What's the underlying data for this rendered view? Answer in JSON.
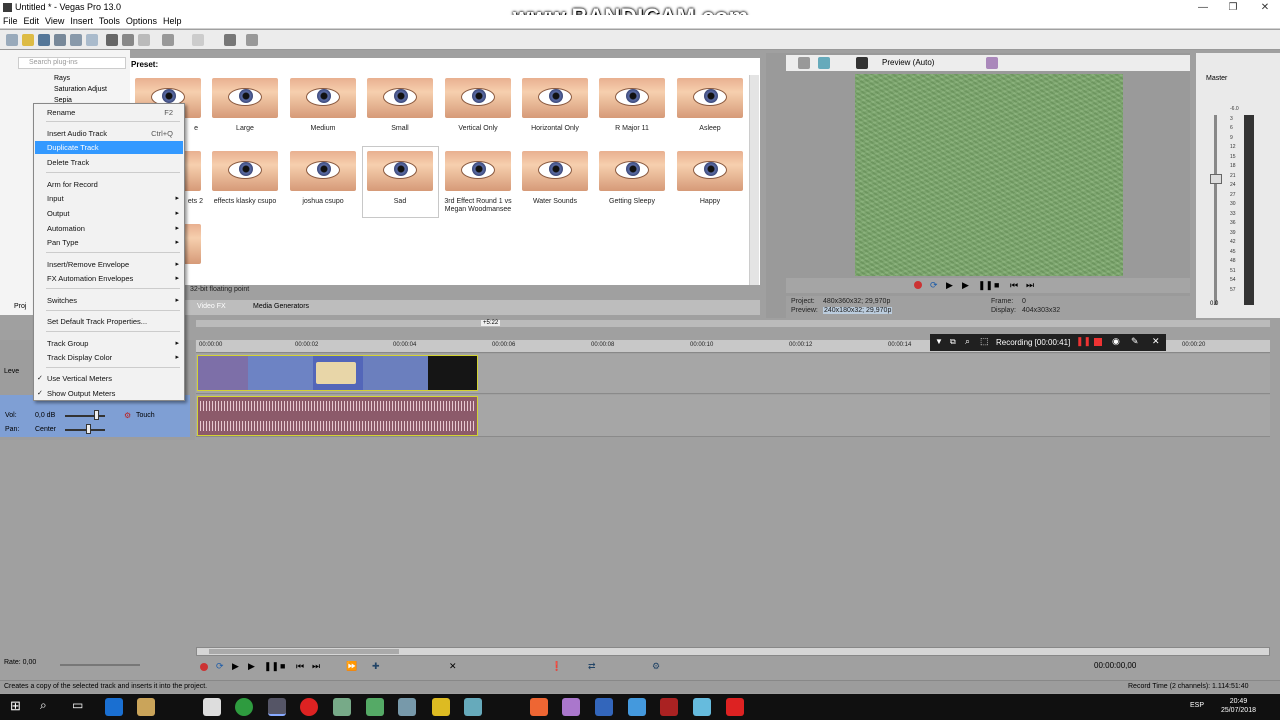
{
  "window": {
    "title": "Untitled * - Vegas Pro 13.0",
    "minimize": "—",
    "maximize": "❐",
    "close": "✕"
  },
  "watermark": "www.BANDICAM.com",
  "menu": [
    "File",
    "Edit",
    "View",
    "Insert",
    "Tools",
    "Options",
    "Help"
  ],
  "left_panel": {
    "search_placeholder": "Search plug-ins",
    "items": [
      "Rays",
      "Saturation Adjust",
      "Sepia"
    ],
    "tab_label": "Proj"
  },
  "presets": {
    "label": "Preset:",
    "row1": [
      "Large",
      "Medium",
      "Small",
      "Vertical Only",
      "Horizontal Only",
      "R Major 11",
      "Asleep"
    ],
    "row2": [
      "effects klasky csupo",
      "joshua csupo",
      "Sad",
      "3rd Effect Round 1 vs Megan Woodmansee",
      "Water Sounds",
      "Getting Sleepy",
      "Happy"
    ],
    "partial1": "e",
    "partial2": "ets 2",
    "selected": "Sad",
    "status": "32-bit floating point"
  },
  "tabs": [
    "Video FX",
    "Media Generators"
  ],
  "preview": {
    "mode": "Preview (Auto)",
    "project_label": "Project:",
    "project_value": "480x360x32; 29,970p",
    "preview_label": "Preview:",
    "preview_value": "240x180x32; 29,970p",
    "frame_label": "Frame:",
    "frame_value": "0",
    "display_label": "Display:",
    "display_value": "404x303x32"
  },
  "master": {
    "title": "Master",
    "scale": [
      "-6.0",
      "3",
      "6",
      "9",
      "12",
      "15",
      "18",
      "21",
      "24",
      "27",
      "30",
      "33",
      "36",
      "39",
      "42",
      "45",
      "48",
      "51",
      "54",
      "57"
    ],
    "value": "0.0"
  },
  "ruler": {
    "marker": "+5:22",
    "ticks": [
      "00:00:00",
      "00:00:02",
      "00:00:04",
      "00:00:06",
      "00:00:08",
      "00:00:10",
      "00:00:12",
      "00:00:14",
      "00:00:20"
    ]
  },
  "recording": {
    "label": "Recording [00:00:41]"
  },
  "audio_track": {
    "vol_label": "Vol:",
    "vol_value": "0,0 dB",
    "pan_label": "Pan:",
    "pan_value": "Center",
    "mode": "Touch",
    "level_label": "Leve"
  },
  "context_menu": [
    {
      "label": "Rename",
      "shortcut": "F2"
    },
    {
      "label": "Insert Audio Track",
      "shortcut": "Ctrl+Q"
    },
    {
      "label": "Duplicate Track",
      "shortcut": ""
    },
    {
      "label": "Delete Track",
      "shortcut": ""
    },
    {
      "label": "Arm for Record",
      "shortcut": ""
    },
    {
      "label": "Input",
      "shortcut": ""
    },
    {
      "label": "Output",
      "shortcut": ""
    },
    {
      "label": "Automation",
      "shortcut": ""
    },
    {
      "label": "Pan Type",
      "shortcut": ""
    },
    {
      "label": "Insert/Remove Envelope",
      "shortcut": ""
    },
    {
      "label": "FX Automation Envelopes",
      "shortcut": ""
    },
    {
      "label": "Switches",
      "shortcut": ""
    },
    {
      "label": "Set Default Track Properties...",
      "shortcut": ""
    },
    {
      "label": "Track Group",
      "shortcut": ""
    },
    {
      "label": "Track Display Color",
      "shortcut": ""
    },
    {
      "label": "Use Vertical Meters",
      "shortcut": ""
    },
    {
      "label": "Show Output Meters",
      "shortcut": ""
    }
  ],
  "rate": "Rate: 0,00",
  "timecode": "00:00:00,00",
  "status": {
    "left": "Creates a copy of the selected track and inserts it into the project.",
    "right": "Record Time (2 channels): 1.114:51:40"
  },
  "taskbar": {
    "time": "20:49",
    "date": "25/07/2018",
    "lang": "ESP"
  },
  "colors": {
    "selection": "#3399ff",
    "preview_bg": "#7aa86a",
    "clip_border": "#d3d332",
    "audio_clip": "#8c5a6a"
  }
}
